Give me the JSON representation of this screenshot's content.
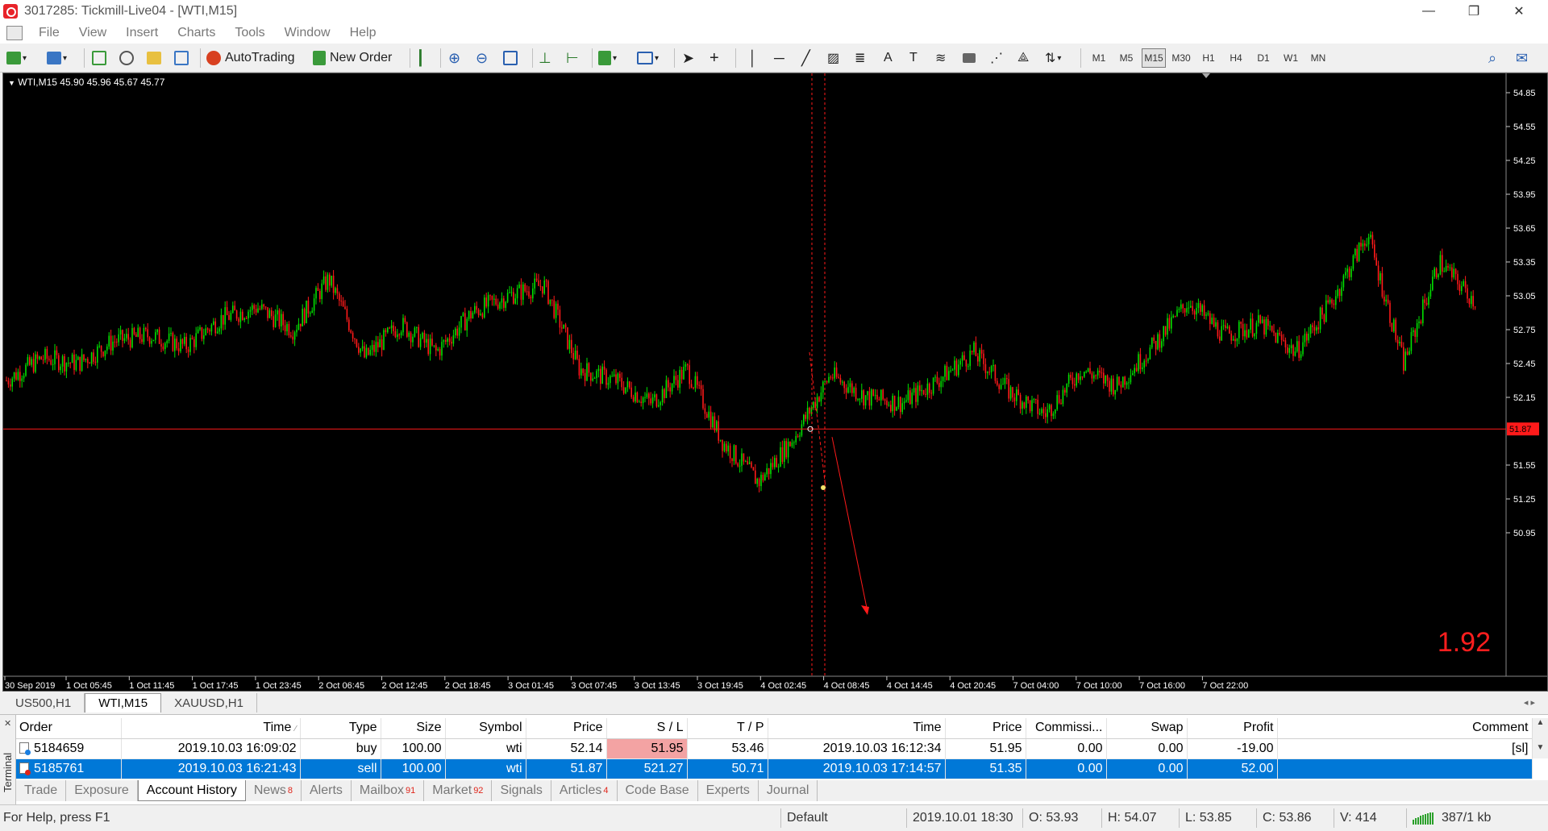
{
  "window": {
    "title": "3017285: Tickmill-Live04 - [WTI,M15]",
    "controls": {
      "minimize": "—",
      "restore": "❐",
      "close": "✕"
    }
  },
  "menu": {
    "items": [
      "File",
      "View",
      "Insert",
      "Charts",
      "Tools",
      "Window",
      "Help"
    ]
  },
  "toolbar": {
    "autotrading_label": "AutoTrading",
    "new_order_label": "New Order",
    "timeframes": [
      "M1",
      "M5",
      "M15",
      "M30",
      "H1",
      "H4",
      "D1",
      "W1",
      "MN"
    ],
    "active_timeframe": "M15"
  },
  "chart": {
    "legend": "WTI,M15  45.90 45.96 45.67 45.77",
    "big_value": "1.92",
    "price_line": 51.87,
    "price_line_label": "51.87",
    "y_ticks": [
      "54.85",
      "54.55",
      "54.25",
      "53.95",
      "53.65",
      "53.35",
      "53.05",
      "52.75",
      "52.45",
      "52.15",
      "51.55",
      "51.25",
      "50.95"
    ],
    "x_ticks": [
      "30 Sep 2019",
      "1 Oct 05:45",
      "1 Oct 11:45",
      "1 Oct 17:45",
      "1 Oct 23:45",
      "2 Oct 06:45",
      "2 Oct 12:45",
      "2 Oct 18:45",
      "3 Oct 01:45",
      "3 Oct 07:45",
      "3 Oct 13:45",
      "3 Oct 19:45",
      "4 Oct 02:45",
      "4 Oct 08:45",
      "4 Oct 14:45",
      "4 Oct 20:45",
      "7 Oct 04:00",
      "7 Oct 10:00",
      "7 Oct 16:00",
      "7 Oct 22:00"
    ],
    "colors": {
      "bull": "#00e000",
      "bear": "#ff1a1a",
      "background": "#000000",
      "grid_text": "#ffffff"
    },
    "path_points": [
      52.3,
      52.5,
      52.45,
      52.65,
      52.7,
      52.6,
      52.85,
      52.95,
      52.75,
      53.2,
      52.5,
      52.8,
      52.55,
      52.9,
      53.05,
      53.15,
      52.4,
      52.3,
      52.1,
      52.4,
      51.75,
      51.4,
      51.8,
      52.35,
      52.15,
      52.1,
      52.3,
      52.55,
      52.2,
      52.0,
      52.4,
      52.25,
      52.6,
      53.0,
      52.7,
      52.8,
      52.55,
      53.0,
      53.6,
      52.45,
      53.35,
      53.0
    ]
  },
  "chart_tabs": [
    {
      "label": "US500,H1"
    },
    {
      "label": "WTI,M15",
      "active": true
    },
    {
      "label": "XAUUSD,H1"
    }
  ],
  "terminal": {
    "side_label": "Terminal",
    "columns": [
      "Order",
      "Time",
      "Type",
      "Size",
      "Symbol",
      "Price",
      "S / L",
      "T / P",
      "Time",
      "Price",
      "Commissi...",
      "Swap",
      "Profit",
      "Comment"
    ],
    "rows": [
      {
        "order": "5184659",
        "open_time": "2019.10.03 16:09:02",
        "type": "buy",
        "size": "100.00",
        "symbol": "wti",
        "price": "52.14",
        "sl": "51.95",
        "tp": "53.46",
        "close_time": "2019.10.03 16:12:34",
        "close_price": "51.95",
        "commission": "0.00",
        "swap": "0.00",
        "profit": "-19.00",
        "comment": "[sl]"
      },
      {
        "order": "5185761",
        "open_time": "2019.10.03 16:21:43",
        "type": "sell",
        "size": "100.00",
        "symbol": "wti",
        "price": "51.87",
        "sl": "521.27",
        "tp": "50.71",
        "close_time": "2019.10.03 17:14:57",
        "close_price": "51.35",
        "commission": "0.00",
        "swap": "0.00",
        "profit": "52.00",
        "comment": ""
      }
    ],
    "tabs": [
      {
        "label": "Trade"
      },
      {
        "label": "Exposure"
      },
      {
        "label": "Account History",
        "active": true
      },
      {
        "label": "News",
        "badge": "8"
      },
      {
        "label": "Alerts"
      },
      {
        "label": "Mailbox",
        "badge": "91"
      },
      {
        "label": "Market",
        "badge": "92"
      },
      {
        "label": "Signals"
      },
      {
        "label": "Articles",
        "badge": "4"
      },
      {
        "label": "Code Base"
      },
      {
        "label": "Experts"
      },
      {
        "label": "Journal"
      }
    ]
  },
  "status": {
    "help": "For Help, press F1",
    "profile": "Default",
    "datetime": "2019.10.01 18:30",
    "open": "O: 53.93",
    "high": "H: 54.07",
    "low": "L: 53.85",
    "close": "C: 53.86",
    "volume": "V: 414",
    "traffic": "387/1 kb"
  }
}
